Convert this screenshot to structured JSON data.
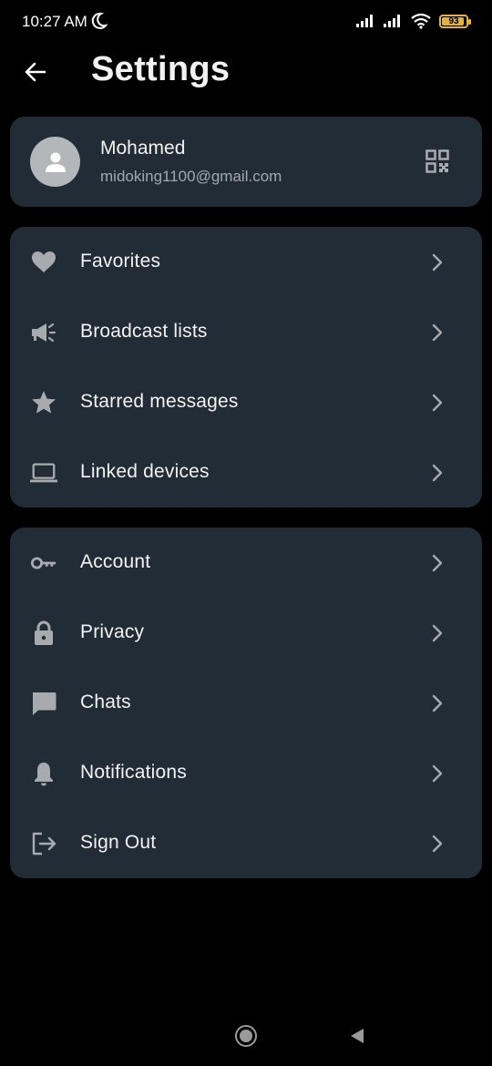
{
  "status_bar": {
    "time": "10:27 AM",
    "battery": "93",
    "battery_level": 0.93,
    "icons": [
      "moon-icon",
      "signal-icon",
      "signal-icon",
      "wifi-icon",
      "battery-icon"
    ],
    "battery_color": "#e5b33b"
  },
  "header": {
    "title": "Settings",
    "back_icon": "arrow-left-icon"
  },
  "profile": {
    "name": "Mohamed",
    "email": "midoking1100@gmail.com",
    "avatar_icon": "person-icon",
    "qr_icon": "qr-code-icon"
  },
  "group1": [
    {
      "label": "Favorites",
      "icon": "heart-icon"
    },
    {
      "label": "Broadcast lists",
      "icon": "megaphone-icon"
    },
    {
      "label": "Starred messages",
      "icon": "star-icon"
    },
    {
      "label": "Linked devices",
      "icon": "laptop-icon"
    }
  ],
  "group2": [
    {
      "label": "Account",
      "icon": "key-icon"
    },
    {
      "label": "Privacy",
      "icon": "lock-icon"
    },
    {
      "label": "Chats",
      "icon": "chat-icon"
    },
    {
      "label": "Notifications",
      "icon": "bell-icon"
    },
    {
      "label": "Sign Out",
      "icon": "sign-out-icon"
    }
  ],
  "colors": {
    "background": "#000000",
    "card": "#212c36",
    "text": "#f2f2f2",
    "secondary_text": "#a2a8ae",
    "icon": "#a7abaf"
  }
}
